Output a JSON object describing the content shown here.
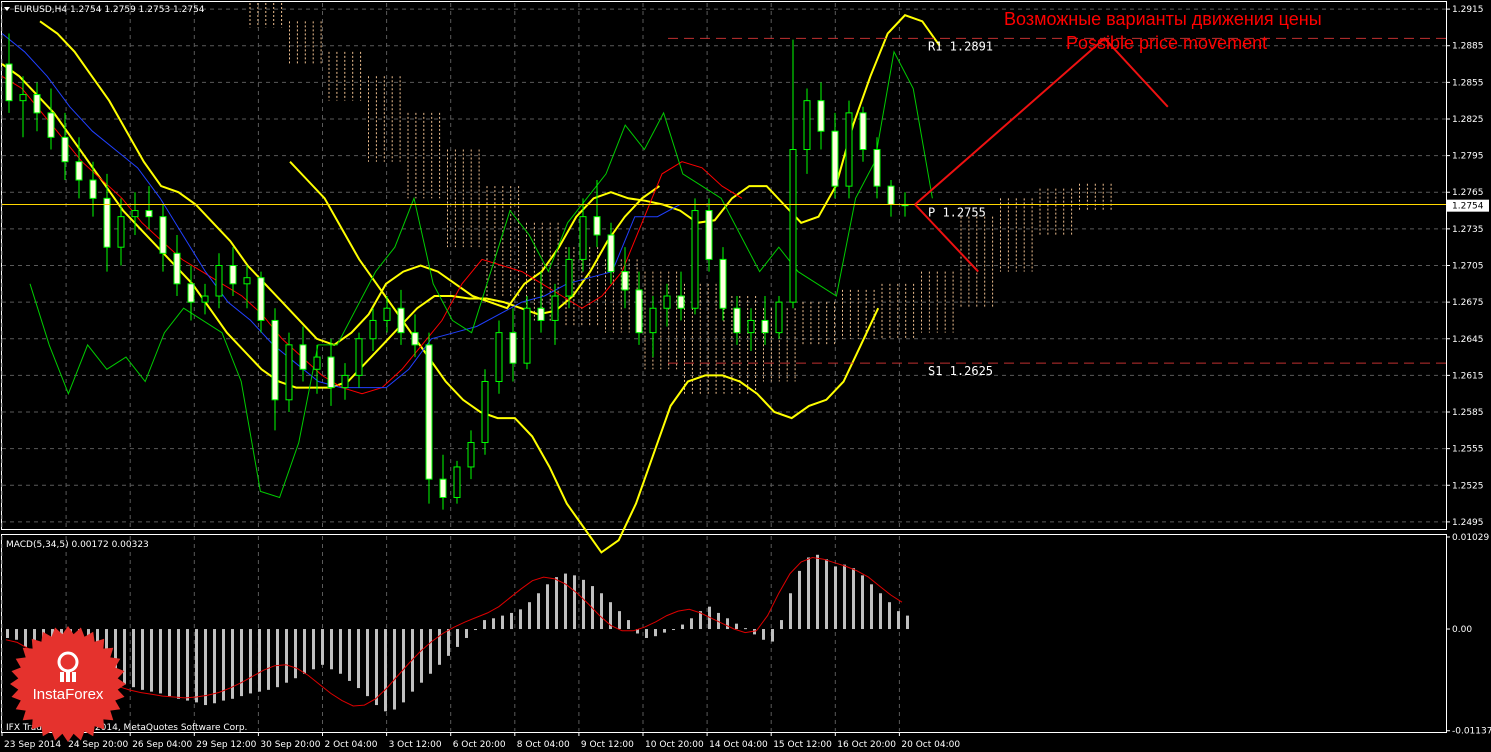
{
  "chart_data": {
    "type": "line",
    "symbol_header": "EURUSD,H4  1.2754 1.2759 1.2753 1.2754",
    "price_axis": {
      "ylim": [
        1.249,
        1.292
      ],
      "ticks": [
        "1.2915",
        "1.2885",
        "1.2855",
        "1.2825",
        "1.2795",
        "1.2765",
        "1.2735",
        "1.2705",
        "1.2675",
        "1.2645",
        "1.2615",
        "1.2585",
        "1.2555",
        "1.2525",
        "1.2495"
      ],
      "current_price": "1.2754"
    },
    "time_axis": {
      "ticks": [
        "23 Sep 2014",
        "24 Sep 20:00",
        "26 Sep 04:00",
        "29 Sep 12:00",
        "30 Sep 20:00",
        "2 Oct 04:00",
        "3 Oct 12:00",
        "6 Oct 20:00",
        "8 Oct 04:00",
        "9 Oct 12:00",
        "10 Oct 20:00",
        "14 Oct 04:00",
        "15 Oct 12:00",
        "16 Oct 20:00",
        "20 Oct 04:00"
      ]
    },
    "levels": [
      {
        "name": "R1",
        "label": "R1  1.2891",
        "value": 1.2891,
        "color": "#b03030"
      },
      {
        "name": "P",
        "label": "P  1.2755",
        "value": 1.2755,
        "color": "#c8a000"
      },
      {
        "name": "S1",
        "label": "S1  1.2625",
        "value": 1.2625,
        "color": "#b03030"
      }
    ],
    "candles": [
      [
        1.287,
        1.2895,
        1.283,
        1.284
      ],
      [
        1.284,
        1.286,
        1.281,
        1.2845
      ],
      [
        1.2845,
        1.2855,
        1.2815,
        1.283
      ],
      [
        1.283,
        1.285,
        1.28,
        1.281
      ],
      [
        1.281,
        1.283,
        1.2775,
        1.279
      ],
      [
        1.279,
        1.281,
        1.276,
        1.2775
      ],
      [
        1.2775,
        1.279,
        1.2745,
        1.276
      ],
      [
        1.276,
        1.278,
        1.27,
        1.272
      ],
      [
        1.272,
        1.276,
        1.2705,
        1.2745
      ],
      [
        1.2745,
        1.2765,
        1.273,
        1.275
      ],
      [
        1.275,
        1.277,
        1.2735,
        1.2745
      ],
      [
        1.2745,
        1.2755,
        1.27,
        1.2715
      ],
      [
        1.2715,
        1.273,
        1.268,
        1.269
      ],
      [
        1.269,
        1.2705,
        1.266,
        1.2675
      ],
      [
        1.2675,
        1.269,
        1.2665,
        1.268
      ],
      [
        1.268,
        1.2715,
        1.267,
        1.2705
      ],
      [
        1.2705,
        1.272,
        1.268,
        1.269
      ],
      [
        1.269,
        1.2705,
        1.267,
        1.2695
      ],
      [
        1.2695,
        1.27,
        1.265,
        1.266
      ],
      [
        1.266,
        1.267,
        1.257,
        1.2595
      ],
      [
        1.2595,
        1.265,
        1.2585,
        1.264
      ],
      [
        1.264,
        1.2655,
        1.261,
        1.262
      ],
      [
        1.262,
        1.264,
        1.26,
        1.263
      ],
      [
        1.263,
        1.2645,
        1.259,
        1.2605
      ],
      [
        1.2605,
        1.2625,
        1.2595,
        1.2615
      ],
      [
        1.2615,
        1.265,
        1.2605,
        1.2645
      ],
      [
        1.2645,
        1.267,
        1.2635,
        1.266
      ],
      [
        1.266,
        1.268,
        1.265,
        1.267
      ],
      [
        1.267,
        1.2685,
        1.264,
        1.265
      ],
      [
        1.265,
        1.2665,
        1.263,
        1.264
      ],
      [
        1.264,
        1.265,
        1.251,
        1.253
      ],
      [
        1.253,
        1.255,
        1.2505,
        1.2515
      ],
      [
        1.2515,
        1.2545,
        1.251,
        1.254
      ],
      [
        1.254,
        1.257,
        1.253,
        1.256
      ],
      [
        1.256,
        1.262,
        1.255,
        1.261
      ],
      [
        1.261,
        1.266,
        1.26,
        1.265
      ],
      [
        1.265,
        1.267,
        1.261,
        1.2625
      ],
      [
        1.2625,
        1.268,
        1.262,
        1.267
      ],
      [
        1.267,
        1.27,
        1.265,
        1.266
      ],
      [
        1.266,
        1.269,
        1.264,
        1.268
      ],
      [
        1.268,
        1.272,
        1.267,
        1.271
      ],
      [
        1.271,
        1.276,
        1.27,
        1.2745
      ],
      [
        1.2745,
        1.2775,
        1.272,
        1.273
      ],
      [
        1.273,
        1.274,
        1.269,
        1.27
      ],
      [
        1.27,
        1.272,
        1.267,
        1.2685
      ],
      [
        1.2685,
        1.27,
        1.264,
        1.265
      ],
      [
        1.265,
        1.268,
        1.263,
        1.267
      ],
      [
        1.267,
        1.269,
        1.2655,
        1.268
      ],
      [
        1.268,
        1.27,
        1.266,
        1.267
      ],
      [
        1.267,
        1.276,
        1.2665,
        1.275
      ],
      [
        1.275,
        1.276,
        1.27,
        1.271
      ],
      [
        1.271,
        1.272,
        1.266,
        1.267
      ],
      [
        1.267,
        1.268,
        1.264,
        1.265
      ],
      [
        1.265,
        1.267,
        1.2635,
        1.266
      ],
      [
        1.266,
        1.268,
        1.264,
        1.265
      ],
      [
        1.265,
        1.268,
        1.2645,
        1.2675
      ],
      [
        1.2675,
        1.289,
        1.267,
        1.28
      ],
      [
        1.28,
        1.285,
        1.278,
        1.284
      ],
      [
        1.284,
        1.2855,
        1.28,
        1.2815
      ],
      [
        1.2815,
        1.283,
        1.276,
        1.277
      ],
      [
        1.277,
        1.284,
        1.276,
        1.283
      ],
      [
        1.283,
        1.2835,
        1.279,
        1.28
      ],
      [
        1.28,
        1.281,
        1.276,
        1.277
      ],
      [
        1.277,
        1.2775,
        1.2745,
        1.2755
      ],
      [
        1.2755,
        1.2765,
        1.2745,
        1.2754
      ]
    ],
    "series": [
      {
        "name": "",
        "color": "#ffff00",
        "values": [
          1.2905,
          1.2895,
          1.288,
          1.286,
          1.284,
          1.2815,
          1.279,
          1.277,
          1.2765,
          1.2755,
          1.274,
          1.2725,
          1.2705,
          1.269,
          1.2675,
          1.266,
          1.2645,
          1.264,
          1.265,
          1.2665,
          1.269,
          1.27,
          1.2705,
          1.27,
          1.269,
          1.268,
          1.2675,
          1.267,
          1.269,
          1.27,
          1.272,
          1.2745,
          1.276,
          1.2765,
          1.276,
          1.2758,
          1.2755,
          1.275,
          1.274,
          1.2742,
          1.276,
          1.277,
          1.277,
          1.2755,
          1.274,
          1.2745,
          1.277,
          1.282,
          1.286,
          1.2895,
          1.291,
          1.2905,
          1.2885
        ]
      },
      {
        "name": "",
        "color": "#ffff00",
        "values": [
          1.287,
          1.286,
          1.2845,
          1.283,
          1.281,
          1.279,
          1.277,
          1.275,
          1.2735,
          1.272,
          1.2705,
          1.269,
          1.267,
          1.265,
          1.2635,
          1.262,
          1.261,
          1.2605,
          1.2605,
          1.2605,
          1.261,
          1.2625,
          1.264,
          1.2655,
          1.267,
          1.268,
          1.268,
          1.2678,
          1.2678,
          1.2675,
          1.267,
          1.2665,
          1.2668,
          1.268,
          1.27,
          1.2725,
          1.2745,
          1.276,
          1.277
        ]
      },
      {
        "name": "",
        "color": "#ffff00",
        "values": [
          1.279,
          1.2775,
          1.276,
          1.2735,
          1.271,
          1.269,
          1.267,
          1.265,
          1.263,
          1.261,
          1.2595,
          1.2585,
          1.258,
          1.258,
          1.2565,
          1.254,
          1.251,
          1.249,
          1.247,
          1.248,
          1.251,
          1.255,
          1.259,
          1.261,
          1.2615,
          1.2615,
          1.261,
          1.26,
          1.2585,
          1.258,
          1.259,
          1.2595,
          1.261,
          1.264,
          1.267
        ]
      },
      {
        "name": "",
        "color": "#ff0000",
        "values": [
          1.286,
          1.285,
          1.283,
          1.281,
          1.279,
          1.2775,
          1.276,
          1.274,
          1.2725,
          1.271,
          1.27,
          1.269,
          1.268,
          1.2665,
          1.2645,
          1.263,
          1.2615,
          1.2605,
          1.26,
          1.2605,
          1.262,
          1.264,
          1.266,
          1.269,
          1.271,
          1.2705,
          1.27,
          1.269,
          1.268,
          1.267,
          1.268,
          1.27,
          1.274,
          1.278,
          1.279,
          1.2785,
          1.277,
          1.276
        ]
      },
      {
        "name": "",
        "color": "#2040ff",
        "values": [
          1.2895,
          1.288,
          1.286,
          1.2835,
          1.2815,
          1.28,
          1.2785,
          1.276,
          1.273,
          1.27,
          1.2675,
          1.266,
          1.264,
          1.2625,
          1.261,
          1.2605,
          1.2605,
          1.2605,
          1.262,
          1.2645,
          1.265,
          1.2655,
          1.2665,
          1.2675,
          1.268,
          1.269,
          1.2695,
          1.27,
          1.2745,
          1.2745,
          1.2755,
          1.2755
        ]
      },
      {
        "name": "",
        "color": "#00cc00",
        "values": [
          1.269,
          1.264,
          1.26,
          1.264,
          1.262,
          1.263,
          1.261,
          1.265,
          1.267,
          1.266,
          1.265,
          1.261,
          1.252,
          1.2515,
          1.256,
          1.264,
          1.264,
          1.267,
          1.27,
          1.272,
          1.276,
          1.269,
          1.266,
          1.265,
          1.27,
          1.275,
          1.273,
          1.27,
          1.274,
          1.276,
          1.278,
          1.282,
          1.28,
          1.283,
          1.278,
          1.277,
          1.276,
          1.273,
          1.27,
          1.272,
          1.27,
          1.269,
          1.268,
          1.276,
          1.279,
          1.288,
          1.285,
          1.276
        ]
      }
    ],
    "cloud": [
      {
        "top": 1.292,
        "bottom": 1.29
      },
      {
        "top": 1.2905,
        "bottom": 1.287
      },
      {
        "top": 1.288,
        "bottom": 1.284
      },
      {
        "top": 1.286,
        "bottom": 1.279
      },
      {
        "top": 1.283,
        "bottom": 1.276
      },
      {
        "top": 1.28,
        "bottom": 1.272
      },
      {
        "top": 1.277,
        "bottom": 1.268
      },
      {
        "top": 1.274,
        "bottom": 1.266
      },
      {
        "top": 1.272,
        "bottom": 1.2655
      },
      {
        "top": 1.271,
        "bottom": 1.265
      },
      {
        "top": 1.27,
        "bottom": 1.262
      },
      {
        "top": 1.269,
        "bottom": 1.26
      },
      {
        "top": 1.268,
        "bottom": 1.26
      },
      {
        "top": 1.267,
        "bottom": 1.261
      },
      {
        "top": 1.2675,
        "bottom": 1.264
      },
      {
        "top": 1.2685,
        "bottom": 1.2645
      },
      {
        "top": 1.269,
        "bottom": 1.2645
      },
      {
        "top": 1.27,
        "bottom": 1.265
      },
      {
        "top": 1.2745,
        "bottom": 1.267
      },
      {
        "top": 1.276,
        "bottom": 1.27
      },
      {
        "top": 1.2768,
        "bottom": 1.273
      },
      {
        "top": 1.2772,
        "bottom": 1.275
      }
    ],
    "macd": {
      "label": "MACD(5,34,5) 0.00172 0.00323",
      "ylim": [
        -0.0114,
        0.0104
      ],
      "ticks": [
        "0.01029",
        "0.00",
        "-0.01137"
      ],
      "histogram": [
        -0.001,
        -0.0012,
        -0.002,
        -0.003,
        -0.0035,
        -0.004,
        -0.0042,
        -0.0045,
        -0.0048,
        -0.005,
        -0.0055,
        -0.0058,
        -0.006,
        -0.0062,
        -0.0065,
        -0.0068,
        -0.007,
        -0.0072,
        -0.0075,
        -0.0078,
        -0.008,
        -0.0082,
        -0.0085,
        -0.0083,
        -0.008,
        -0.0078,
        -0.0075,
        -0.0072,
        -0.007,
        -0.0068,
        -0.0065,
        -0.006,
        -0.0055,
        -0.005,
        -0.0045,
        -0.004,
        -0.0045,
        -0.005,
        -0.0058,
        -0.0066,
        -0.0075,
        -0.0085,
        -0.0092,
        -0.009,
        -0.0082,
        -0.007,
        -0.006,
        -0.005,
        -0.004,
        -0.003,
        -0.002,
        -0.001,
        0.0,
        0.001,
        0.0012,
        0.0015,
        0.0018,
        0.0022,
        0.003,
        0.004,
        0.005,
        0.0058,
        0.0062,
        0.006,
        0.0055,
        0.0048,
        0.004,
        0.003,
        0.002,
        0.001,
        -0.0005,
        -0.001,
        -0.0008,
        -0.0004,
        0.0,
        0.0005,
        0.0012,
        0.002,
        0.0025,
        0.0018,
        0.0012,
        0.0006,
        0.0001,
        -0.0006,
        -0.0012,
        -0.0014,
        0.001,
        0.004,
        0.0065,
        0.008,
        0.0083,
        0.0078,
        0.007,
        0.0072,
        0.0068,
        0.006,
        0.005,
        0.004,
        0.003,
        0.002,
        0.0015
      ],
      "signal": [
        -0.0012,
        -0.0015,
        -0.0022,
        -0.003,
        -0.0037,
        -0.0043,
        -0.0048,
        -0.0052,
        -0.0056,
        -0.006,
        -0.0064,
        -0.0068,
        -0.0071,
        -0.0073,
        -0.0075,
        -0.0076,
        -0.0077,
        -0.0076,
        -0.0074,
        -0.0071,
        -0.0066,
        -0.006,
        -0.0053,
        -0.0046,
        -0.0041,
        -0.004,
        -0.0044,
        -0.0052,
        -0.0062,
        -0.0072,
        -0.008,
        -0.0086,
        -0.0085,
        -0.0078,
        -0.0066,
        -0.0052,
        -0.0038,
        -0.0025,
        -0.0014,
        -0.0005,
        0.0002,
        0.0008,
        0.0013,
        0.0018,
        0.0025,
        0.0035,
        0.0045,
        0.0054,
        0.0058,
        0.0056,
        0.005,
        0.004,
        0.0028,
        0.0015,
        0.0004,
        -0.0002,
        -0.0002,
        0.0002,
        0.0008,
        0.0015,
        0.002,
        0.0022,
        0.0018,
        0.0012,
        0.0006,
        0.0,
        -0.0004,
        -0.0002,
        0.0015,
        0.004,
        0.0062,
        0.0075,
        0.008,
        0.0078,
        0.0074,
        0.007,
        0.0065,
        0.0058,
        0.0048,
        0.0038,
        0.003
      ]
    },
    "annotations": [
      {
        "text": "Возможные варианты движения цены",
        "color": "#ff0000"
      },
      {
        "text": "Possible price movement",
        "color": "#ff0000"
      }
    ],
    "scenario_paths": [
      [
        [
          1.2755,
          0
        ],
        [
          1.2891,
          24
        ],
        [
          1.2835,
          8
        ]
      ],
      [
        [
          1.2755,
          0
        ],
        [
          1.27,
          8
        ]
      ]
    ]
  },
  "footer": {
    "copyright": "IFX Trader, © 2001-2014, MetaQuotes Software Corp."
  },
  "logo": {
    "brand": "InstaForex",
    "color": "#e5322d"
  }
}
